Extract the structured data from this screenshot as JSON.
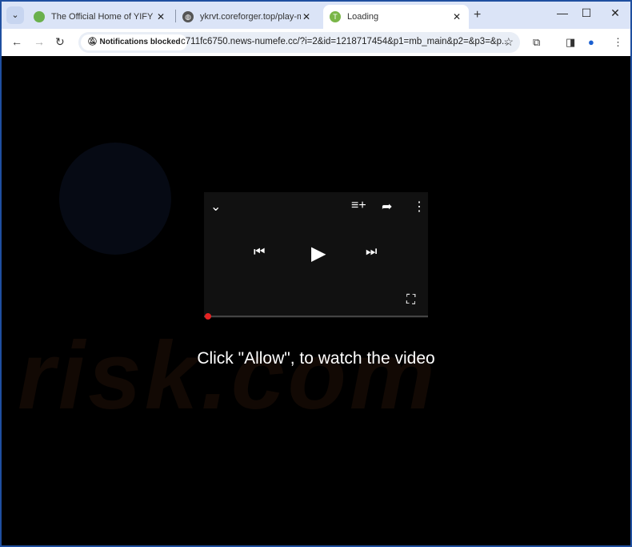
{
  "tabs": [
    {
      "title": "The Official Home of YIFY Movi",
      "favicon": "yts-icon",
      "color": "#6ab04c"
    },
    {
      "title": "ykrvt.coreforger.top/play-music",
      "favicon": "globe-icon",
      "color": "#555555"
    },
    {
      "title": "Loading",
      "favicon": "T",
      "color": "#7ab648"
    }
  ],
  "toolbar": {
    "notification_chip": "Notifications blocked",
    "url": "c711fc6750.news-numefe.cc/?i=2&id=1218717454&p1=mb_main&p2=&p3=&p..."
  },
  "page": {
    "message": "Click \"Allow\", to watch the video",
    "watermark": "risk.com"
  }
}
